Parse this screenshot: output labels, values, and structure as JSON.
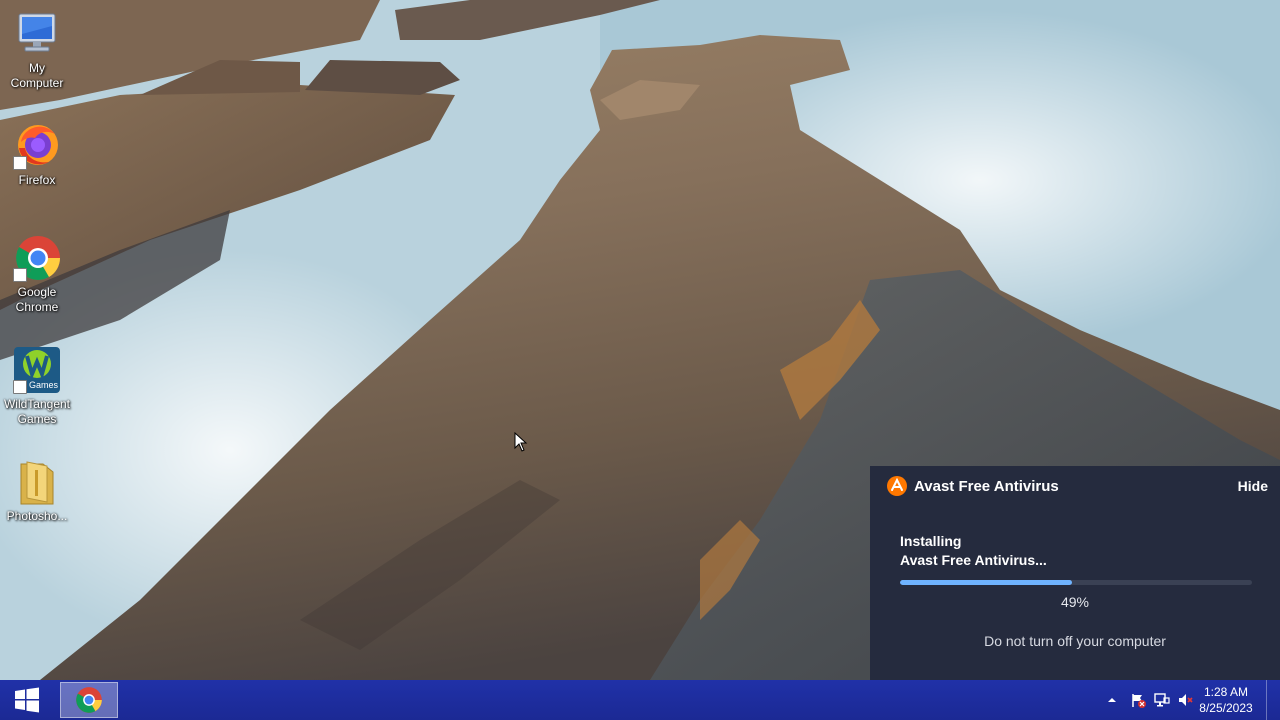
{
  "desktop": {
    "icons": [
      {
        "label": "My\nComputer",
        "icon": "computer-icon"
      },
      {
        "label": "Firefox",
        "icon": "firefox-icon"
      },
      {
        "label": "Google\nChrome",
        "icon": "chrome-icon"
      },
      {
        "label": "WildTangent\nGames",
        "icon": "wildtangent-icon",
        "badge": "Games"
      },
      {
        "label": "Photosho...",
        "icon": "folder-icon"
      }
    ]
  },
  "avast": {
    "title": "Avast Free Antivirus",
    "hide_label": "Hide",
    "status_line1": "Installing",
    "status_line2": "Avast Free Antivirus...",
    "progress": 0.49,
    "progress_text": "49%",
    "warning": "Do not turn off your computer",
    "accent_color": "#ff7800",
    "progress_color": "#6fb3ff"
  },
  "taskbar": {
    "start_icon": "windows-logo-icon",
    "pinned": [
      {
        "icon": "chrome-icon",
        "active": true
      }
    ],
    "tray": {
      "icons": [
        "chevron-up-icon",
        "action-center-flag-icon",
        "network-icon",
        "volume-muted-icon"
      ],
      "time": "1:28 AM",
      "date": "8/25/2023"
    },
    "color": "#1c2a9c"
  }
}
